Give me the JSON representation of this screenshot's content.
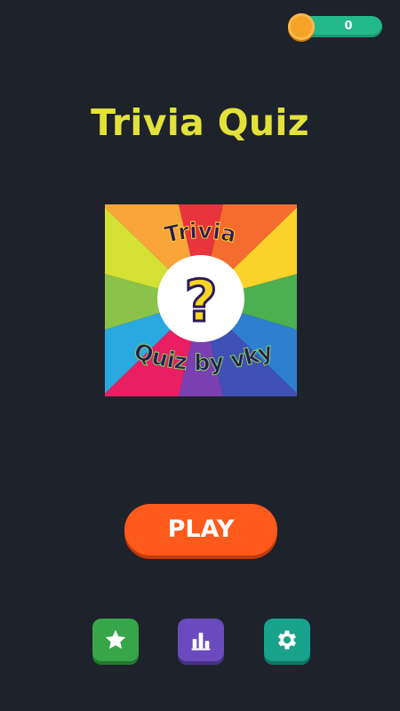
{
  "coins": {
    "value": "0",
    "icon": "coin-icon"
  },
  "title": "Trivia Quiz",
  "logo": {
    "top_text": "Trivia",
    "bottom_text": "Quiz by vky",
    "symbol": "?"
  },
  "play_button": {
    "label": "PLAY"
  },
  "bottom_buttons": [
    {
      "name": "favorites",
      "icon": "star-icon",
      "color": "#37a64a"
    },
    {
      "name": "leaderboard",
      "icon": "bar-chart-icon",
      "color": "#6a4bbd"
    },
    {
      "name": "settings",
      "icon": "gear-icon",
      "color": "#19a38a"
    }
  ],
  "colors": {
    "background": "#1e222b",
    "title": "#e2e23a",
    "play": "#fd5a1c",
    "coin_bar": "#22b98a"
  }
}
